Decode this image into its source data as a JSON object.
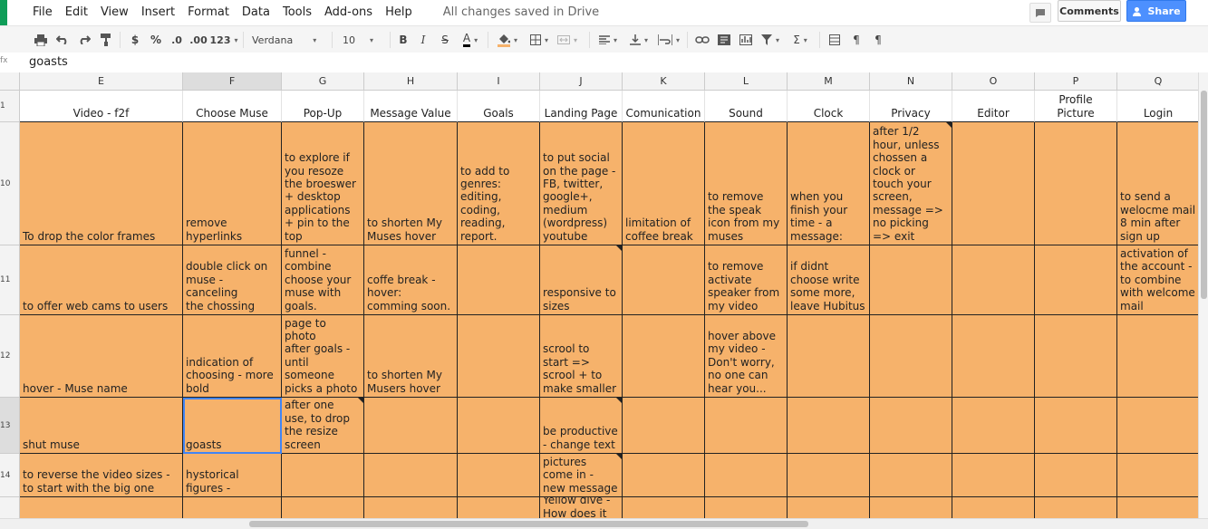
{
  "menubar": {
    "items": [
      "File",
      "Edit",
      "View",
      "Insert",
      "Format",
      "Data",
      "Tools",
      "Add-ons",
      "Help"
    ],
    "saved_status": "All changes saved in Drive",
    "comments_label": "Comments",
    "share_label": "Share"
  },
  "toolbar": {
    "currency": "$",
    "percent": "%",
    "dec_less": ".0",
    "dec_more": ".00",
    "more_formats": "123",
    "font": "Verdana",
    "font_size": "10",
    "bold": "B",
    "italic": "I",
    "strike": "S",
    "text_color": "A",
    "sigma": "Σ",
    "pilcrow": "¶"
  },
  "formula_bar": {
    "label": "fx",
    "value": "goasts"
  },
  "columns": [
    "E",
    "F",
    "G",
    "H",
    "I",
    "J",
    "K",
    "L",
    "M",
    "N",
    "O",
    "P",
    "Q"
  ],
  "row_numbers": [
    "1",
    "10",
    "11",
    "12",
    "13",
    "14",
    ""
  ],
  "header_row": [
    "Video - f2f",
    "Choose Muse",
    "Pop-Up",
    "Message Value",
    "Goals",
    "Landing Page",
    "Comunication",
    "Sound",
    "Clock",
    "Privacy",
    "Editor",
    "Profile\nPicture",
    "Login"
  ],
  "rows": [
    [
      "To drop the color frames",
      "remove\nhyperlinks",
      "to explore if\nyou resoze\nthe broeswer\n+ desktop\napplications\n+ pin to the\ntop",
      "to shorten My\nMuses hover",
      "to add to\ngenres:\nediting,\ncoding,\nreading,\nreport.",
      "to put social\non the page -\nFB, twitter,\ngoogle+,\nmedium\n(wordpress)\nyoutube",
      "limitation of\ncoffee break",
      "to remove\nthe speak\nicon from my\nmuses",
      "when you\nfinish your\ntime - a\nmessage:",
      "after 1/2\nhour, unless\nchossen a\nclock or\ntouch your\nscreen,\nmessage =>\nno picking\n=> exit",
      "",
      "",
      "to send a\nwelocme mail\n8 min after\nsign up"
    ],
    [
      "to offer web cams to users",
      "double click on\nmuse - canceling\nthe chossing",
      "funnel -\ncombine\nchoose your\nmuse with\ngoals.",
      "coffe break -\nhover:\ncomming soon.",
      "",
      "responsive to\nsizes",
      "",
      "to remove\nactivate\nspeaker from\nmy video",
      "if didnt\nchoose write\nsome more,\nleave Hubitus",
      "",
      "",
      "",
      "activation of\nthe account -\nto combine\nwith welcome\nmail"
    ],
    [
      "hover - Muse name",
      "indication of\nchoosing - more\nbold",
      "to add a new\npage to photo\nafter goals -\nuntil\nsomeone\npicks a photo",
      "to shorten My\nMusers hover",
      "",
      "scrool to\nstart =>\nscrool + to\nmake smaller",
      "",
      "hover above\nmy video -\nDon't worry,\nno one can\nhear you...",
      "",
      "",
      "",
      "",
      ""
    ],
    [
      "shut muse",
      "goasts",
      "after one\nuse, to drop\nthe resize\nscreen",
      "",
      "",
      "be productive\n- change text",
      "",
      "",
      "",
      "",
      "",
      "",
      ""
    ],
    [
      "to reverse the video sizes -\nto start with the big one",
      "hystorical\nfigures -",
      "",
      "",
      "",
      "when pictures\ncome in -\nnew message",
      "",
      "",
      "",
      "",
      "",
      "",
      ""
    ],
    [
      "",
      "",
      "",
      "",
      "",
      "Yellow dive -\nHow does it",
      "",
      "",
      "",
      "",
      "",
      "",
      ""
    ]
  ],
  "colors": {
    "cell_fill": "#f6b26b",
    "share_button": "#4d90fe",
    "selection": "#4285f4"
  }
}
